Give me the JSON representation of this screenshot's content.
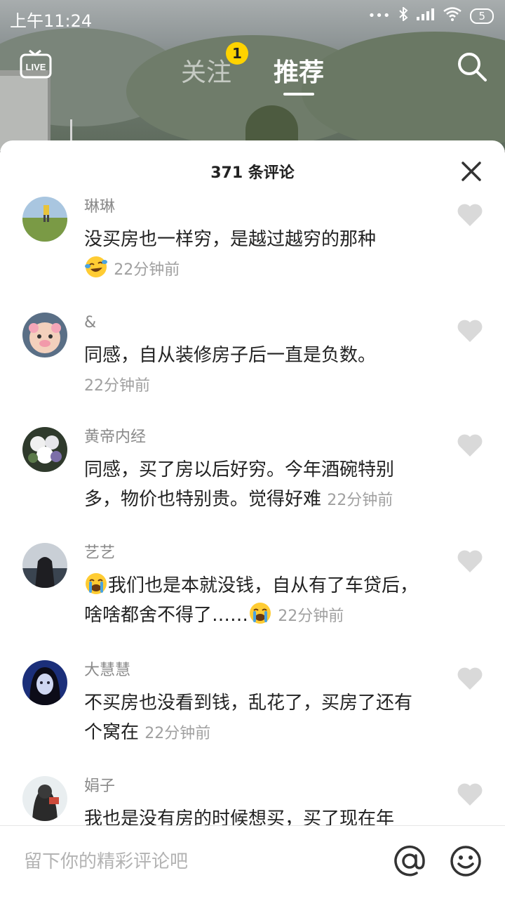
{
  "status": {
    "time": "上午11:24",
    "battery": "5"
  },
  "nav": {
    "live_label": "LIVE",
    "follow_label": "关注",
    "follow_badge": "1",
    "recommend_label": "推荐"
  },
  "sheet": {
    "title": "371 条评论"
  },
  "comments": [
    {
      "user": "琳琳",
      "text": "没买房也一样穷，是越过越穷的那种",
      "time": "22分钟前"
    },
    {
      "user": "&",
      "text": "同感，自从装修房子后一直是负数。",
      "time": "22分钟前"
    },
    {
      "user": "黄帝内经",
      "text": "同感，买了房以后好穷。今年酒碗特别多，物价也特别贵。觉得好难",
      "time": "22分钟前"
    },
    {
      "user": "艺艺",
      "text": "我们也是本就没钱，自从有了车贷后，啥啥都舍不得了……",
      "time": "22分钟前"
    },
    {
      "user": "大慧慧",
      "text": "不买房也没看到钱，乱花了，买房了还有个窝在",
      "time": "22分钟前"
    },
    {
      "user": "娟子",
      "text": "我也是没有房的时候想买，买了现在年",
      "time": ""
    }
  ],
  "input": {
    "placeholder": "留下你的精彩评论吧"
  },
  "colors": {
    "badge": "#ffd300",
    "name": "#8a8a8a",
    "time": "#a0a0a0",
    "text": "#222222"
  },
  "icons": [
    "live-icon",
    "search-icon",
    "close-icon",
    "heart-icon",
    "at-icon",
    "smile-icon",
    "laugh-cry-emoji",
    "crying-emoji"
  ]
}
